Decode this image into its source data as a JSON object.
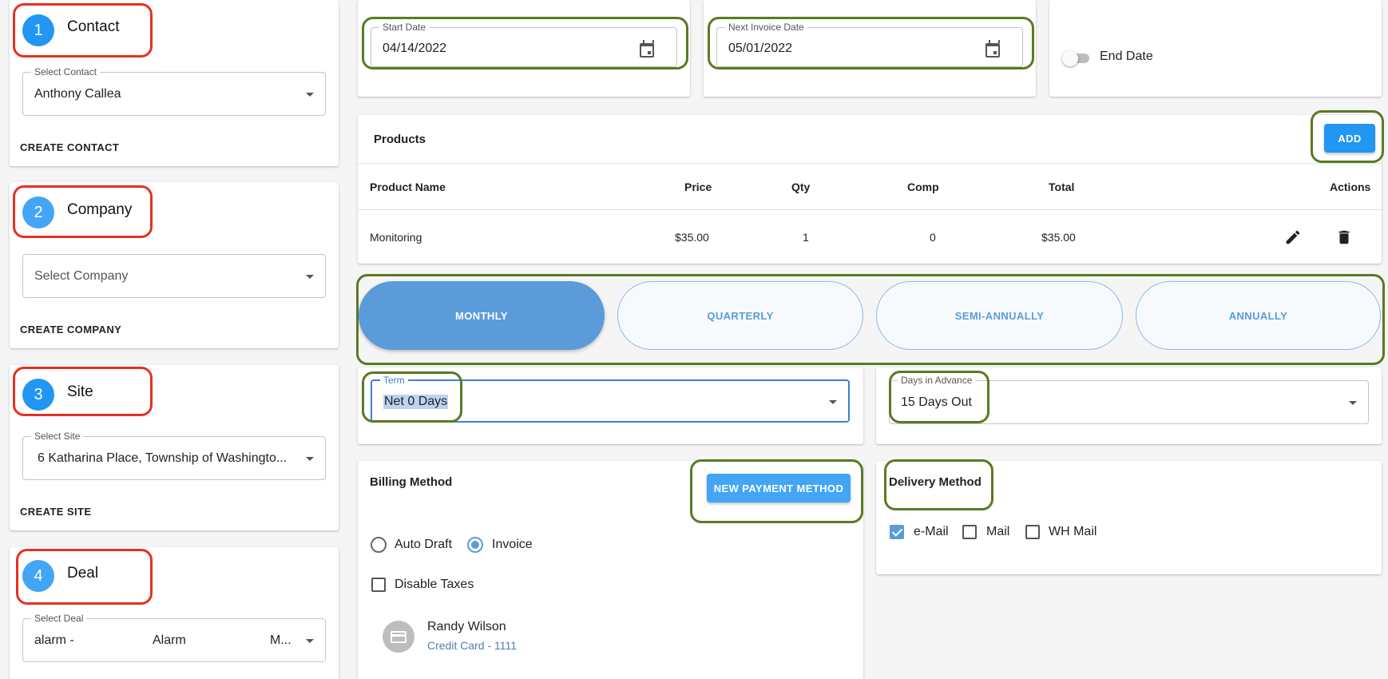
{
  "steps": [
    {
      "number": "1",
      "title": "Contact",
      "field_label": "Select Contact",
      "field_value": "Anthony Callea",
      "action": "CREATE CONTACT"
    },
    {
      "number": "2",
      "title": "Company",
      "field_label": "",
      "field_value": "Select Company",
      "action": "CREATE COMPANY"
    },
    {
      "number": "3",
      "title": "Site",
      "field_label": "Select Site",
      "field_value": "6 Katharina Place, Township of Washingto...",
      "action": "CREATE SITE"
    },
    {
      "number": "4",
      "title": "Deal",
      "field_label": "Select Deal",
      "field_value_a": "alarm -",
      "field_value_b": "Alarm",
      "field_value_c": "M..."
    }
  ],
  "dates": {
    "start_label": "Start Date",
    "start_value": "04/14/2022",
    "next_invoice_label": "Next Invoice Date",
    "next_invoice_value": "05/01/2022",
    "end_date_label": "End Date",
    "end_date_enabled": false
  },
  "products": {
    "title": "Products",
    "add_label": "ADD",
    "columns": [
      "Product Name",
      "Price",
      "Qty",
      "Comp",
      "Total",
      "Actions"
    ],
    "rows": [
      {
        "name": "Monitoring",
        "price": "$35.00",
        "qty": "1",
        "comp": "0",
        "total": "$35.00"
      }
    ]
  },
  "frequency": {
    "options": [
      "MONTHLY",
      "QUARTERLY",
      "SEMI-ANNUALLY",
      "ANNUALLY"
    ],
    "selected": "MONTHLY"
  },
  "term": {
    "label": "Term",
    "value": "Net 0 Days"
  },
  "days_in_advance": {
    "label": "Days in Advance",
    "value": "15 Days Out"
  },
  "billing": {
    "title": "Billing Method",
    "new_payment_label": "NEW PAYMENT METHOD",
    "options": [
      "Auto Draft",
      "Invoice"
    ],
    "selected": "Invoice",
    "disable_taxes_label": "Disable Taxes",
    "payment_name": "Randy Wilson",
    "payment_detail": "Credit Card - 1111"
  },
  "delivery": {
    "title": "Delivery Method",
    "options": [
      {
        "label": "e-Mail",
        "checked": true
      },
      {
        "label": "Mail",
        "checked": false
      },
      {
        "label": "WH Mail",
        "checked": false
      }
    ]
  },
  "colors": {
    "accent": "#2196f3",
    "freq_active": "#5b9bd9",
    "highlight_red": "#e53122",
    "highlight_green": "#5a7a22"
  }
}
